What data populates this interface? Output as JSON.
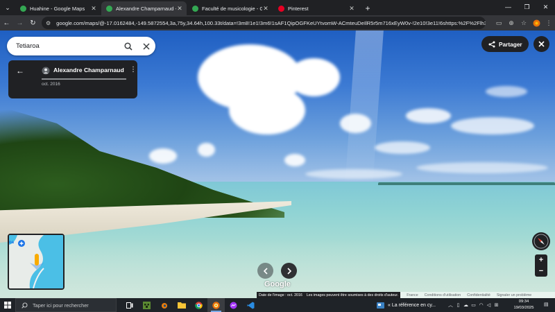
{
  "browser": {
    "tabs": [
      {
        "title": "Huahine - Google Maps",
        "favicon_color": "#34a853"
      },
      {
        "title": "Alexandre Champarnaud - Google Maps",
        "favicon_color": "#34a853"
      },
      {
        "title": "Faculté de musicologie - Google Maps",
        "favicon_color": "#34a853"
      },
      {
        "title": "Pinterest",
        "favicon_color": "#e60023"
      }
    ],
    "active_tab": 1,
    "url": "google.com/maps/@-17.0162484,-149.5872554,3a,75y,34.64h,100.33t/data=!3m8!1e1!3m6!1sAF1QipOGFKeUYtvomW-ACmteuDeIlR5r5m716xEyW0v-!2e10!3e11!6shttps:%2F%2Flh3.googleus..."
  },
  "maps": {
    "search": {
      "value": "Tetiaroa"
    },
    "photo_card": {
      "author": "Alexandre Champarnaud",
      "date": "oct. 2016"
    },
    "share_label": "Partager",
    "logo": "Google",
    "attribution": {
      "image_date": "Date de l'image : oct. 2016",
      "rights": "Les images peuvent être soumises à des droits d'auteur.",
      "links": [
        "France",
        "Conditions d'utilisation",
        "Confidentialité",
        "Signaler un problème"
      ]
    },
    "minimap_label": "oa"
  },
  "taskbar": {
    "search_placeholder": "Taper ici pour rechercher",
    "news": "« La référence en cy...",
    "time": "09:34",
    "date": "19/03/2025"
  },
  "colors": {
    "accent": "#1a73e8",
    "dark_panel": "#202124",
    "taskbar": "#1f2328"
  }
}
